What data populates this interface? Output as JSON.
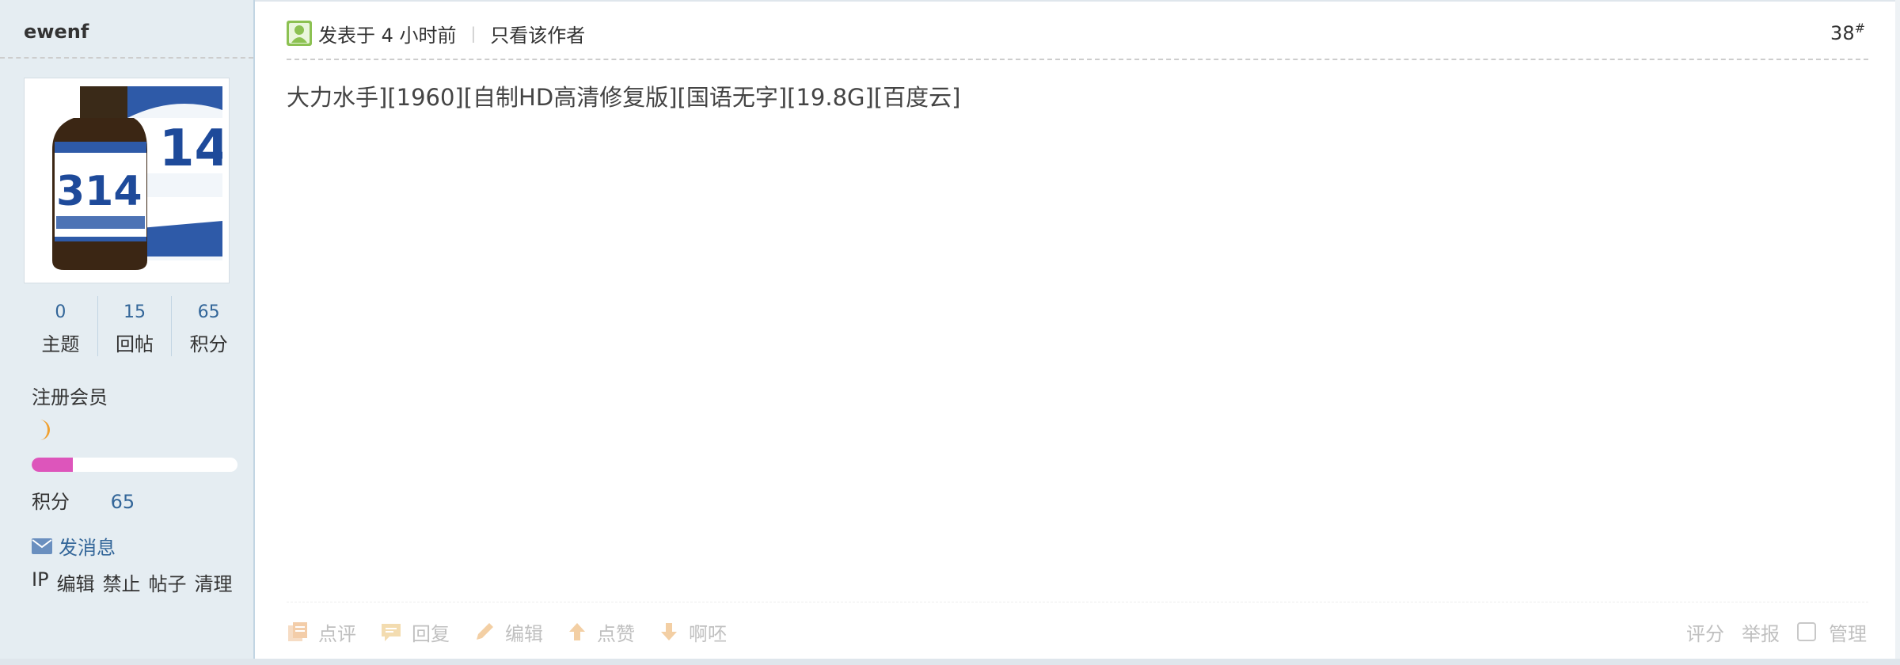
{
  "author": {
    "username": "ewenf",
    "stats": [
      {
        "value": "0",
        "label": "主题"
      },
      {
        "value": "15",
        "label": "回帖"
      },
      {
        "value": "65",
        "label": "积分"
      }
    ],
    "group": "注册会员",
    "rank_icon": "moon-icon",
    "progress_fraction": 0.2,
    "points_label": "积分",
    "points_value": "65",
    "send_message": "发消息",
    "admin_links": [
      "IP",
      "编辑",
      "禁止",
      "帖子",
      "清理"
    ]
  },
  "post": {
    "posted_time": "发表于 4 小时前",
    "only_author": "只看该作者",
    "floor": "38",
    "floor_mark": "#",
    "content": "大力水手][1960][自制HD高清修复版][国语无字][19.8G][百度云]"
  },
  "actions": {
    "left": [
      {
        "label": "点评",
        "icon": "comment-icon"
      },
      {
        "label": "回复",
        "icon": "reply-icon"
      },
      {
        "label": "编辑",
        "icon": "edit-icon"
      },
      {
        "label": "点赞",
        "icon": "thumb-up-icon"
      },
      {
        "label": "啊呸",
        "icon": "thumb-down-icon"
      }
    ],
    "rate": "评分",
    "report": "举报",
    "manage": "管理"
  },
  "colors": {
    "sidebar_bg": "#e5edf2",
    "link": "#336699",
    "progress_fill": "#dd55bb",
    "rank_icon": "#f0a030",
    "disabled_text": "#c0c0c0"
  }
}
